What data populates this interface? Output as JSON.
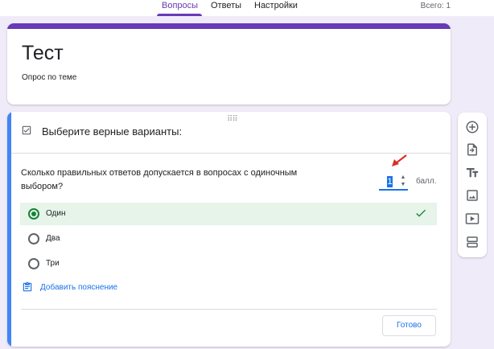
{
  "tabs": [
    {
      "label": "Вопросы",
      "active": true
    },
    {
      "label": "Ответы",
      "active": false
    },
    {
      "label": "Настройки",
      "active": false
    }
  ],
  "total_label": "Всего: 1",
  "form": {
    "title": "Тест",
    "description": "Опрос по теме"
  },
  "question": {
    "header": "Выберите верные варианты:",
    "text": "Сколько правильных ответов допускается в вопросах с одиночным выбором?",
    "points_value": "1",
    "points_label": "балл.",
    "options": [
      {
        "label": "Один",
        "checked": true,
        "correct": true
      },
      {
        "label": "Два",
        "checked": false,
        "correct": false
      },
      {
        "label": "Три",
        "checked": false,
        "correct": false
      }
    ],
    "add_explanation_label": "Добавить пояснение",
    "done_label": "Готово"
  },
  "toolbar_icons": [
    "add-question-icon",
    "import-questions-icon",
    "add-title-icon",
    "add-image-icon",
    "add-video-icon",
    "add-section-icon"
  ],
  "colors": {
    "accent": "#673ab7",
    "focus_blue": "#1a73e8",
    "correct_green": "#188038",
    "correct_bg": "#e6f4ea",
    "background": "#f0ebf8"
  }
}
